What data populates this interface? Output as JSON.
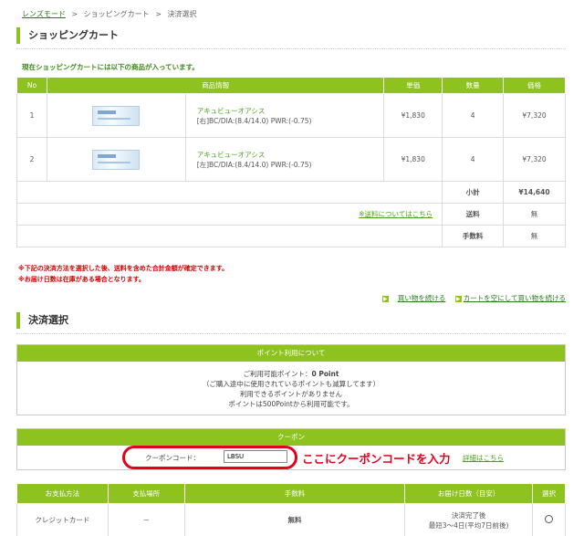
{
  "breadcrumb": {
    "items": [
      "レンズモード",
      "ショッピングカート",
      "決済選択"
    ],
    "sep": ">"
  },
  "cart_section": {
    "title": "ショッピングカート",
    "notice": "現在ショッピングカートには以下の商品が入っています。",
    "headers": [
      "No",
      "商品情報",
      "単価",
      "数量",
      "価格"
    ],
    "items": [
      {
        "no": "1",
        "name": "アキュビューオアシス",
        "spec": "[右]BC/DIA:(8.4/14.0) PWR:(-0.75)",
        "unit_price": "¥1,830",
        "qty": "4",
        "price": "¥7,320"
      },
      {
        "no": "2",
        "name": "アキュビューオアシス",
        "spec": "[左]BC/DIA:(8.4/14.0) PWR:(-0.75)",
        "unit_price": "¥1,830",
        "qty": "4",
        "price": "¥7,320"
      }
    ],
    "subtotal_label": "小計",
    "subtotal_value": "¥14,640",
    "shipping_link": "※送料についてはこちら",
    "shipping_label": "送料",
    "shipping_value": "無",
    "fee_label": "手数料",
    "fee_value": "無"
  },
  "notes": {
    "note1": "※下記の決済方法を選択した後、送料を含めた合計金額が確定できます。",
    "note2": "※お届け日数は在庫がある場合となります。"
  },
  "links": {
    "continue": "買い物を続ける",
    "empty_continue": "カートを空にして買い物を続ける"
  },
  "payment_section": {
    "title": "決済選択"
  },
  "points": {
    "header": "ポイント利用について",
    "line1_prefix": "ご利用可能ポイント：",
    "line1_value": "0 Point",
    "line2": "（ご購入途中に使用されているポイントも減算してます）",
    "line3": "利用できるポイントがありません",
    "line4": "ポイントは500Pointから利用可能です。"
  },
  "coupon": {
    "header": "クーポン",
    "label": "クーポンコード：",
    "value": "LBSU",
    "hint": "ここにクーポンコードを入力",
    "detail_link": "詳細はこちら"
  },
  "payment_table": {
    "headers": [
      "お支払方法",
      "支払場所",
      "手数料",
      "お届け日数（目安）",
      "選択"
    ],
    "rows": [
      {
        "method": "クレジットカード",
        "place": "－",
        "fee": "無料",
        "delivery1": "決済完了後",
        "delivery2": "最短3～4日(平均7日前後)"
      }
    ]
  },
  "colors": {
    "accent": "#8dc21f",
    "alert": "#d40000",
    "link": "#4aa01a",
    "annotation": "#e3001b"
  }
}
